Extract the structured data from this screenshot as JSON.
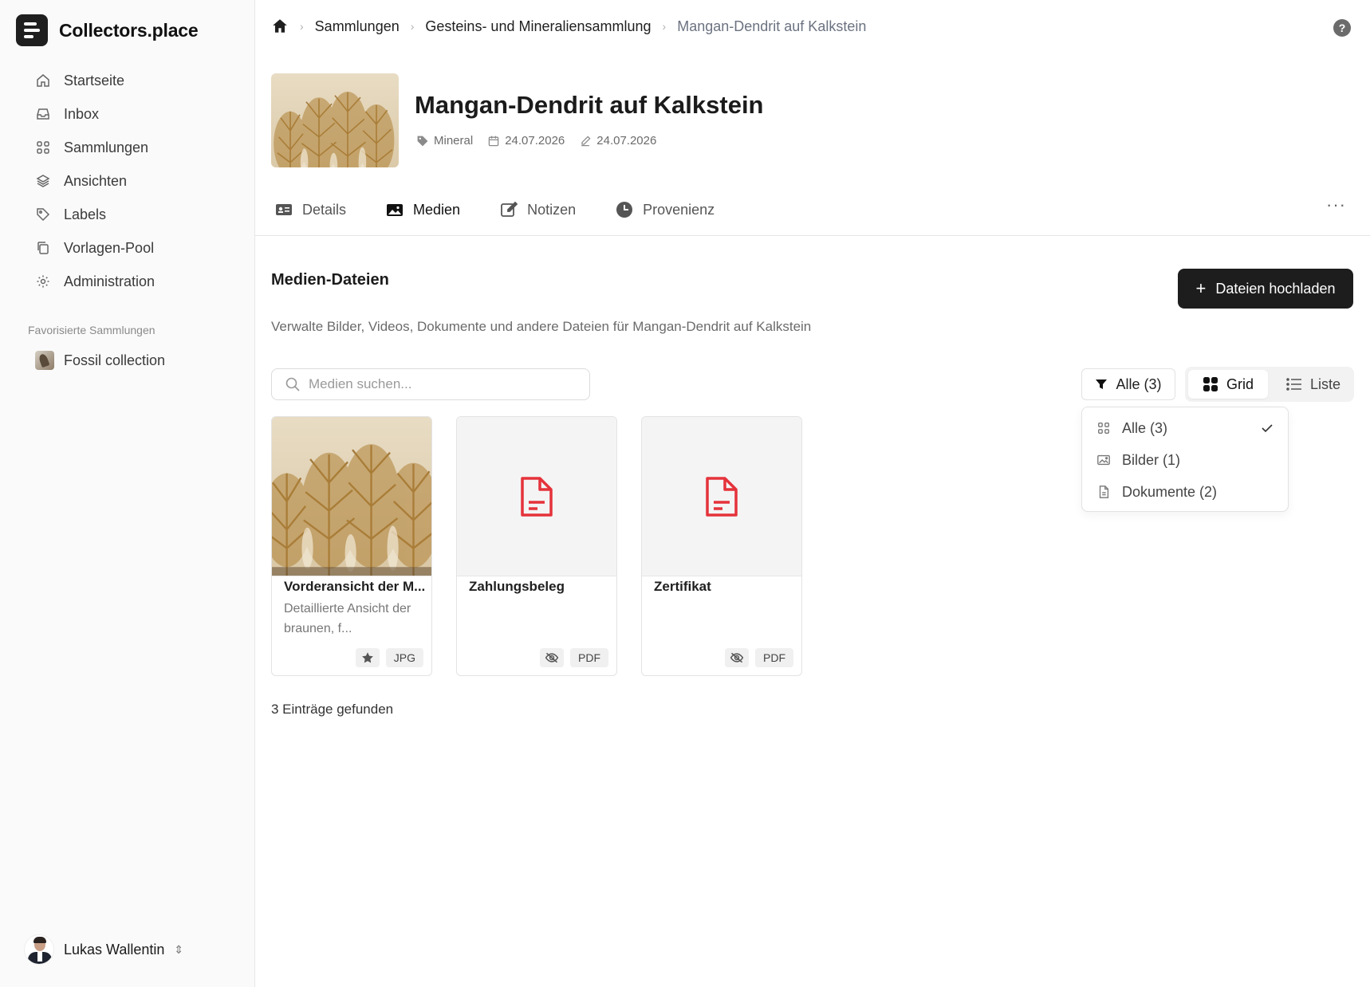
{
  "brand": {
    "name": "Collectors.place"
  },
  "sidebar": {
    "items": [
      {
        "label": "Startseite",
        "icon": "home-icon"
      },
      {
        "label": "Inbox",
        "icon": "inbox-icon"
      },
      {
        "label": "Sammlungen",
        "icon": "grid-icon"
      },
      {
        "label": "Ansichten",
        "icon": "layers-icon"
      },
      {
        "label": "Labels",
        "icon": "tag-icon"
      },
      {
        "label": "Vorlagen-Pool",
        "icon": "copy-icon"
      },
      {
        "label": "Administration",
        "icon": "gear-icon"
      }
    ],
    "favorites_heading": "Favorisierte Sammlungen",
    "favorites": [
      {
        "label": "Fossil collection"
      }
    ]
  },
  "user": {
    "name": "Lukas Wallentin"
  },
  "breadcrumb": {
    "items": [
      "Sammlungen",
      "Gesteins- und Mineraliensammlung"
    ],
    "current": "Mangan-Dendrit auf Kalkstein"
  },
  "item": {
    "title": "Mangan-Dendrit auf Kalkstein",
    "type": "Mineral",
    "created": "24.07.2026",
    "modified": "24.07.2026"
  },
  "tabs": [
    {
      "label": "Details",
      "icon": "id-card-icon"
    },
    {
      "label": "Medien",
      "icon": "image-icon",
      "active": true
    },
    {
      "label": "Notizen",
      "icon": "edit-icon"
    },
    {
      "label": "Provenienz",
      "icon": "clock-icon"
    }
  ],
  "media": {
    "section_title": "Medien-Dateien",
    "upload_label": "Dateien hochladen",
    "description": "Verwalte Bilder, Videos, Dokumente und andere Dateien für Mangan-Dendrit auf Kalkstein",
    "search_placeholder": "Medien suchen...",
    "filter_label": "Alle (3)",
    "view_grid_label": "Grid",
    "view_list_label": "Liste",
    "filter_options": [
      {
        "label": "Alle (3)",
        "icon": "grid-icon",
        "selected": true
      },
      {
        "label": "Bilder (1)",
        "icon": "image-icon"
      },
      {
        "label": "Dokumente (2)",
        "icon": "file-icon"
      }
    ],
    "cards": [
      {
        "title": "Vorderansicht der M...",
        "description": "Detaillierte Ansicht der braunen, f...",
        "format": "JPG",
        "kind": "image",
        "badge_icon": "star-icon"
      },
      {
        "title": "Zahlungsbeleg",
        "description": "",
        "format": "PDF",
        "kind": "document",
        "badge_icon": "eye-off-icon"
      },
      {
        "title": "Zertifikat",
        "description": "",
        "format": "PDF",
        "kind": "document",
        "badge_icon": "eye-off-icon"
      }
    ],
    "results_text": "3 Einträge gefunden"
  },
  "colors": {
    "primary": "#1d1d1d",
    "pdf_red": "#e5323b",
    "muted": "#6b6b6b"
  }
}
